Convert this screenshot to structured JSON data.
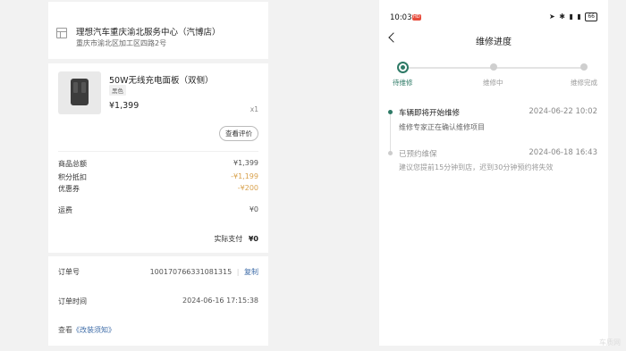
{
  "store": {
    "name": "理想汽车重庆渝北服务中心（汽博店）",
    "address": "重庆市渝北区加工区四路2号"
  },
  "product": {
    "name": "50W无线充电面板（双侧）",
    "variant": "黑色",
    "price": "¥1,399",
    "qty": "x1",
    "review_label": "查看评价"
  },
  "summary": [
    {
      "label": "商品总额",
      "value": "¥1,399"
    },
    {
      "label": "积分抵扣",
      "value": "-¥1,199"
    },
    {
      "label": "优惠券",
      "value": "-¥200"
    },
    {
      "label": "运费",
      "value": "¥0"
    }
  ],
  "paid": {
    "label": "实际支付",
    "value": "¥0"
  },
  "order_info": {
    "order_no_label": "订单号",
    "order_no": "100170766331081315",
    "copy_label": "复制",
    "order_time_label": "订单时间",
    "order_time": "2024-06-16 17:15:38",
    "view_prefix": "查看",
    "notice_link": "《改装须知》"
  },
  "phone": {
    "time": "10:03",
    "hd": "HD",
    "status_icons": "➤ ✱ ▮ ▮",
    "battery": "66",
    "title": "维修进度"
  },
  "steps": [
    {
      "label": "待维修",
      "active": true
    },
    {
      "label": "维修中",
      "active": false
    },
    {
      "label": "维修完成",
      "active": false
    }
  ],
  "events": [
    {
      "title": "车辆即将开始维修",
      "time": "2024-06-22 10:02",
      "desc": "维修专家正在确认维修项目"
    },
    {
      "title": "已预约维保",
      "time": "2024-06-18 16:43",
      "desc": "建议您提前15分钟到店，迟到30分钟预约将失效"
    }
  ],
  "colors": {
    "accent": "#2e7a66",
    "deduction": "#d9a24e",
    "link": "#3f6da8"
  },
  "watermark": "车质网"
}
